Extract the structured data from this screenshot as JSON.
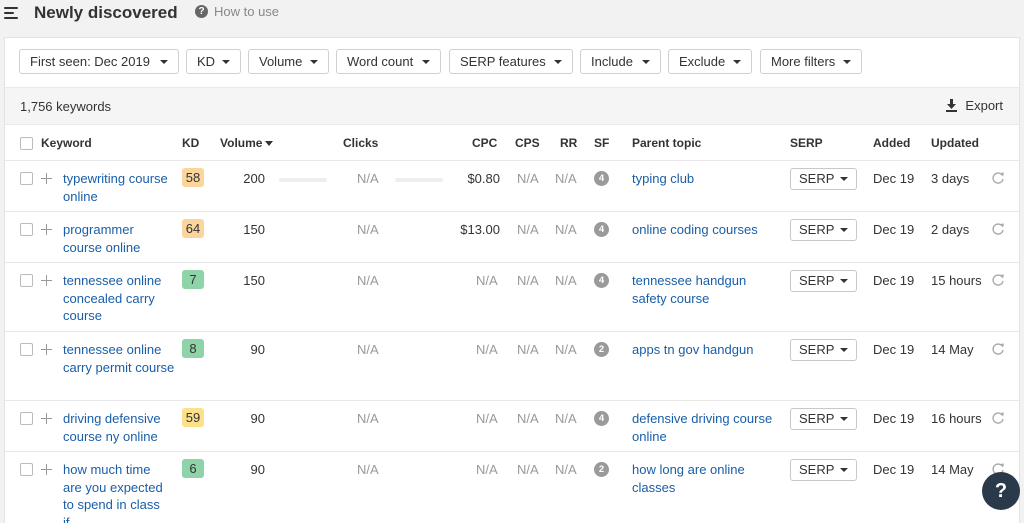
{
  "header": {
    "title": "Newly discovered",
    "help_label": "How to use"
  },
  "filters": [
    {
      "label": "First seen: Dec 2019"
    },
    {
      "label": "KD"
    },
    {
      "label": "Volume"
    },
    {
      "label": "Word count"
    },
    {
      "label": "SERP features"
    },
    {
      "label": "Include"
    },
    {
      "label": "Exclude"
    },
    {
      "label": "More filters"
    }
  ],
  "summary": {
    "count": "1,756 keywords",
    "export_label": "Export"
  },
  "columns": {
    "keyword": "Keyword",
    "kd": "KD",
    "volume": "Volume",
    "clicks": "Clicks",
    "cpc": "CPC",
    "cps": "CPS",
    "rr": "RR",
    "sf": "SF",
    "parent_topic": "Parent topic",
    "serp": "SERP",
    "added": "Added",
    "updated": "Updated"
  },
  "colors": {
    "kd_orange": "#fbd59b",
    "kd_green": "#8fd4a8",
    "kd_yellow": "#fde08a",
    "link": "#1a5ea8"
  },
  "rows": [
    {
      "keyword": "typewriting course online",
      "kd": "58",
      "kd_color": "#fbd59b",
      "volume": "200",
      "clicks": "N/A",
      "cpc": "$0.80",
      "cps": "N/A",
      "rr": "N/A",
      "sf": "4",
      "parent": "typing club",
      "serp": "SERP",
      "added": "Dec 19",
      "updated": "3 days"
    },
    {
      "keyword": "programmer course online",
      "kd": "64",
      "kd_color": "#fbd59b",
      "volume": "150",
      "clicks": "N/A",
      "cpc": "$13.00",
      "cps": "N/A",
      "rr": "N/A",
      "sf": "4",
      "parent": "online coding courses",
      "serp": "SERP",
      "added": "Dec 19",
      "updated": "2 days"
    },
    {
      "keyword": "tennessee online concealed carry course",
      "kd": "7",
      "kd_color": "#8fd4a8",
      "volume": "150",
      "clicks": "N/A",
      "cpc": "N/A",
      "cps": "N/A",
      "rr": "N/A",
      "sf": "4",
      "parent": "tennessee handgun safety course",
      "serp": "SERP",
      "added": "Dec 19",
      "updated": "15 hours"
    },
    {
      "keyword": "tennessee online carry permit course",
      "kd": "8",
      "kd_color": "#8fd4a8",
      "volume": "90",
      "clicks": "N/A",
      "cpc": "N/A",
      "cps": "N/A",
      "rr": "N/A",
      "sf": "2",
      "parent": "apps tn gov handgun",
      "serp": "SERP",
      "added": "Dec 19",
      "updated": "14 May"
    },
    {
      "keyword": "driving defensive course ny online",
      "kd": "59",
      "kd_color": "#fde08a",
      "volume": "90",
      "clicks": "N/A",
      "cpc": "N/A",
      "cps": "N/A",
      "rr": "N/A",
      "sf": "4",
      "parent": "defensive driving course online",
      "serp": "SERP",
      "added": "Dec 19",
      "updated": "16 hours"
    },
    {
      "keyword": "how much time are you expected to spend in class if",
      "kd": "6",
      "kd_color": "#8fd4a8",
      "volume": "90",
      "clicks": "N/A",
      "cpc": "N/A",
      "cps": "N/A",
      "rr": "N/A",
      "sf": "2",
      "parent": "how long are online classes",
      "serp": "SERP",
      "added": "Dec 19",
      "updated": "14 May"
    }
  ],
  "help_fab": "?"
}
